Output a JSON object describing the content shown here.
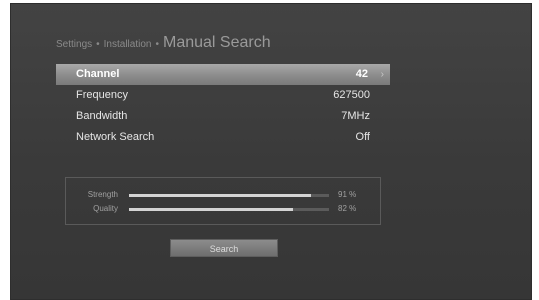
{
  "breadcrumb": {
    "level1": "Settings",
    "separator": "•",
    "level2": "Installation",
    "title": "Manual Search"
  },
  "menu": {
    "items": [
      {
        "label": "Channel",
        "value": "42",
        "selected": true,
        "arrow": "›"
      },
      {
        "label": "Frequency",
        "value": "627500"
      },
      {
        "label": "Bandwidth",
        "value": "7MHz"
      },
      {
        "label": "Network Search",
        "value": "Off"
      }
    ]
  },
  "signal": {
    "strength": {
      "label": "Strength",
      "percent": 91,
      "display": "91 %"
    },
    "quality": {
      "label": "Quality",
      "percent": 82,
      "display": "82 %"
    }
  },
  "search_button": {
    "label": "Search"
  },
  "colors": {
    "background": "#3c3c3c",
    "highlight": "#9a9a9a",
    "text": "#e6e6e6",
    "bar_fill": "#d4d4d4"
  },
  "icons": {
    "selection_arrow": "chevron-right-icon"
  }
}
